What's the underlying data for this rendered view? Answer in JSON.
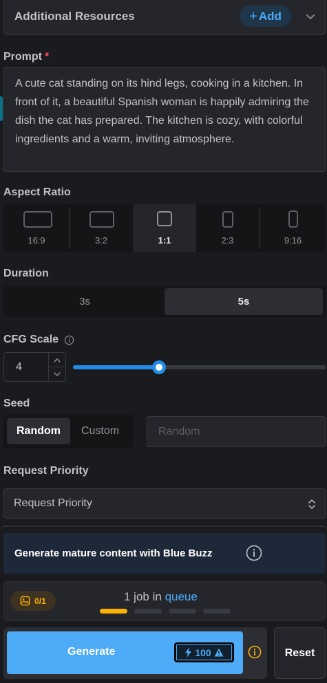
{
  "resources": {
    "title": "Additional Resources",
    "add_label": "Add"
  },
  "prompt": {
    "label": "Prompt",
    "required_mark": "*",
    "value": "A cute cat standing on its hind legs, cooking in a kitchen. In front of it, a beautiful Spanish woman is happily admiring the dish the cat has prepared. The kitchen is cozy, with colorful ingredients and a warm, inviting atmosphere."
  },
  "aspect_ratio": {
    "label": "Aspect Ratio",
    "options": [
      "16:9",
      "3:2",
      "1:1",
      "2:3",
      "9:16"
    ],
    "selected": "1:1"
  },
  "duration": {
    "label": "Duration",
    "options": [
      "3s",
      "5s"
    ],
    "selected": "5s"
  },
  "cfg_scale": {
    "label": "CFG Scale",
    "value": "4",
    "slider_fraction": 0.34
  },
  "seed": {
    "label": "Seed",
    "options": [
      "Random",
      "Custom"
    ],
    "selected": "Random",
    "placeholder": "Random"
  },
  "request_priority": {
    "label": "Request Priority",
    "value": "Request Priority"
  },
  "mature_banner": {
    "text": "Generate mature content with Blue Buzz"
  },
  "queue": {
    "image_count": "0/1",
    "text_prefix": "1 job in",
    "link_text": "queue",
    "slots_filled": 1,
    "slots_total": 4
  },
  "generate": {
    "label": "Generate",
    "cost": "100"
  },
  "reset": {
    "label": "Reset"
  },
  "colors": {
    "accent": "#4dabf7",
    "warning": "#fab005",
    "required": "#fa5252"
  }
}
